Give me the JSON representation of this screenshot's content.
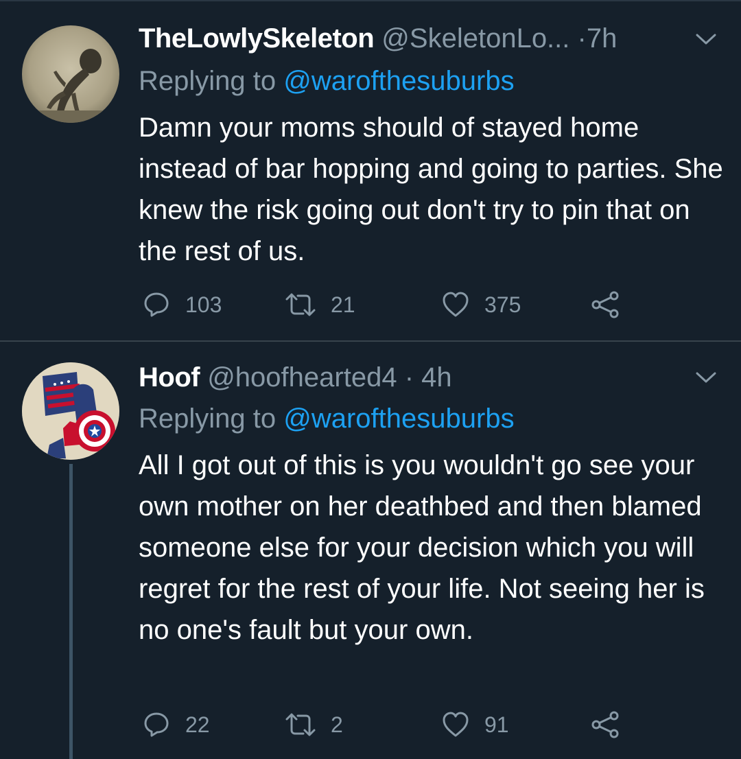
{
  "tweets": [
    {
      "display_name": "TheLowlySkeleton",
      "handle": "@SkeletonLo...",
      "separator": "·",
      "time": "7h",
      "replying_prefix": "Replying to",
      "replying_to": "@warofthesuburbs",
      "text": "Damn your moms should of stayed home instead of bar hopping and going to parties. She knew the risk going out don't try to pin that on the rest of us.",
      "replies": "103",
      "retweets": "21",
      "likes": "375"
    },
    {
      "display_name": "Hoof",
      "handle": "@hoofhearted4",
      "separator": "·",
      "time": "4h",
      "replying_prefix": "Replying to",
      "replying_to": "@warofthesuburbs",
      "text": "All I got out of this is you wouldn't go see your own mother on her deathbed and then blamed someone else for your decision which you will regret for the rest of your life. Not seeing her is no one's fault but your own.",
      "replies": "22",
      "retweets": "2",
      "likes": "91"
    }
  ],
  "icons": {
    "reply": "reply-icon",
    "retweet": "retweet-icon",
    "like": "heart-icon",
    "share": "share-icon",
    "more": "chevron-down-icon"
  },
  "colors": {
    "background": "#15202b",
    "secondary_text": "#8899a6",
    "link": "#1da1f2",
    "divider": "#38444d",
    "thread_line": "#3d5466"
  }
}
